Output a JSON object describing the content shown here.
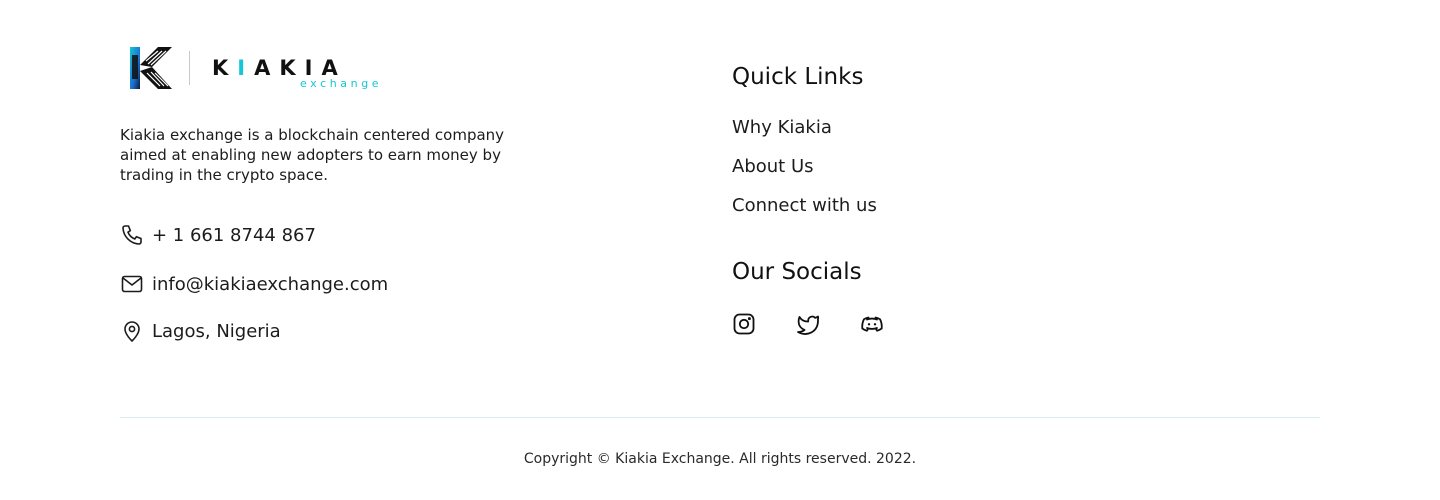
{
  "brand": {
    "name": "KIAKIA",
    "name_accent_letter": "I",
    "sub": "exchange",
    "accent_color": "#14c6d6"
  },
  "about": {
    "description": "Kiakia exchange is a blockchain centered company aimed at enabling new adopters to earn money by trading in the crypto space."
  },
  "contact": {
    "phone": "+ 1 661 8744 867",
    "email": "info@kiakiaexchange.com",
    "location": "Lagos, Nigeria"
  },
  "quick_links": {
    "heading": "Quick Links",
    "items": [
      {
        "label": "Why Kiakia"
      },
      {
        "label": "About Us"
      },
      {
        "label": "Connect with us"
      }
    ]
  },
  "socials": {
    "heading": "Our Socials",
    "items": [
      {
        "icon": "instagram-icon"
      },
      {
        "icon": "twitter-icon"
      },
      {
        "icon": "discord-icon"
      }
    ]
  },
  "footer": {
    "copyright": "Copyright © Kiakia Exchange. All rights reserved. 2022."
  }
}
